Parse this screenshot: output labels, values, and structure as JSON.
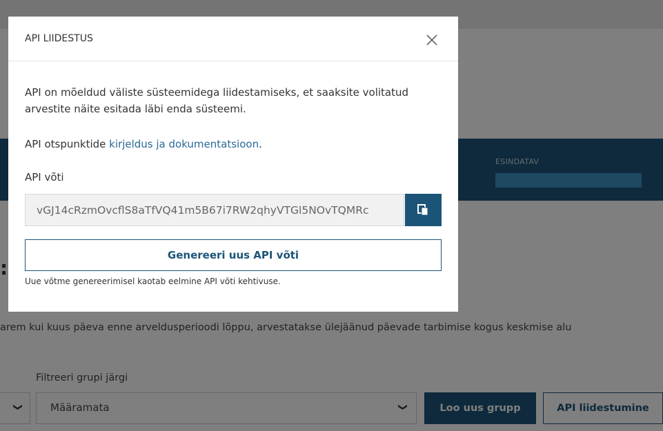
{
  "background": {
    "band": {
      "label": "ESINDATAV"
    },
    "heading_fragment": ":",
    "info_text": "arem kui kuus päeva enne arveldusperioodi lõppu, arvestatakse ülejäänud päevade tarbimise kogus keskmise alu",
    "filter": {
      "label": "Filtreeri grupi järgi",
      "selected": "Määramata"
    },
    "buttons": {
      "create_group": "Loo uus grupp",
      "api_connect": "API liidestumine"
    }
  },
  "modal": {
    "title": "API LIIDESTUS",
    "description": "API on mõeldud väliste süsteemidega liidestamiseks, et saaksite volitatud arvestite näite esitada läbi enda süsteemi.",
    "endpoints_prefix": "API otspunktide ",
    "endpoints_link": "kirjeldus ja dokumentatsioon",
    "endpoints_suffix": ".",
    "key_label": "API võti",
    "key_value": "vGJ14cRzmOvcflS8aTfVQ41m5B67i7RW2qhyVTGl5NOvTQMRc",
    "generate_button": "Genereeri uus API võti",
    "generate_note": "Uue võtme genereerimisel kaotab eelmine API võti kehtivuse."
  },
  "colors": {
    "primary": "#1c5478",
    "link": "#2a6a97",
    "accent_bar": "#3a93c3"
  },
  "icons": {
    "close": "close-icon",
    "copy": "copy-icon",
    "chevron": "chevron-down-icon"
  }
}
